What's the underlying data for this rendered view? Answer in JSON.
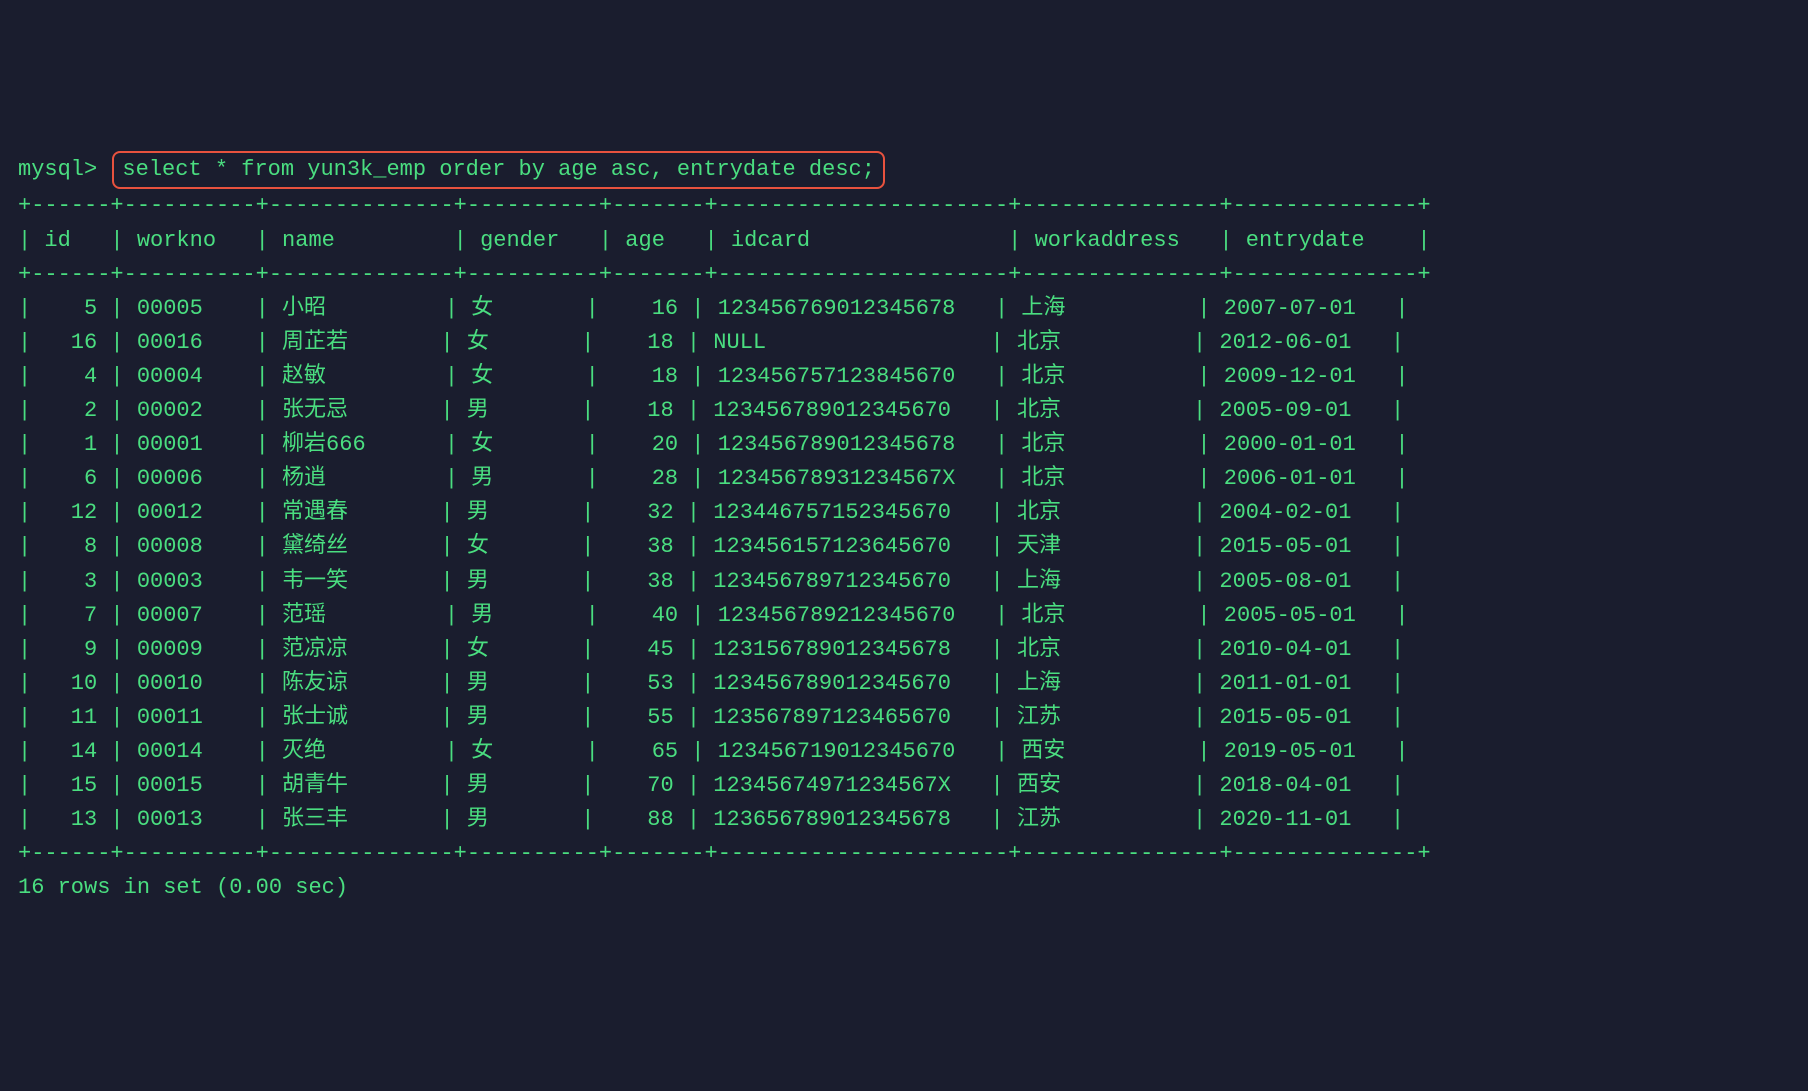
{
  "prompt": "mysql>",
  "query": "select * from yun3k_emp order by age asc, entrydate desc;",
  "columns": [
    "id",
    "workno",
    "name",
    "gender",
    "age",
    "idcard",
    "workaddress",
    "entrydate"
  ],
  "rows": [
    {
      "id": "5",
      "workno": "00005",
      "name": "小昭",
      "gender": "女",
      "age": "16",
      "idcard": "123456769012345678",
      "workaddress": "上海",
      "entrydate": "2007-07-01"
    },
    {
      "id": "16",
      "workno": "00016",
      "name": "周芷若",
      "gender": "女",
      "age": "18",
      "idcard": "NULL",
      "workaddress": "北京",
      "entrydate": "2012-06-01"
    },
    {
      "id": "4",
      "workno": "00004",
      "name": "赵敏",
      "gender": "女",
      "age": "18",
      "idcard": "123456757123845670",
      "workaddress": "北京",
      "entrydate": "2009-12-01"
    },
    {
      "id": "2",
      "workno": "00002",
      "name": "张无忌",
      "gender": "男",
      "age": "18",
      "idcard": "123456789012345670",
      "workaddress": "北京",
      "entrydate": "2005-09-01"
    },
    {
      "id": "1",
      "workno": "00001",
      "name": "柳岩666",
      "gender": "女",
      "age": "20",
      "idcard": "123456789012345678",
      "workaddress": "北京",
      "entrydate": "2000-01-01"
    },
    {
      "id": "6",
      "workno": "00006",
      "name": "杨逍",
      "gender": "男",
      "age": "28",
      "idcard": "12345678931234567X",
      "workaddress": "北京",
      "entrydate": "2006-01-01"
    },
    {
      "id": "12",
      "workno": "00012",
      "name": "常遇春",
      "gender": "男",
      "age": "32",
      "idcard": "123446757152345670",
      "workaddress": "北京",
      "entrydate": "2004-02-01"
    },
    {
      "id": "8",
      "workno": "00008",
      "name": "黛绮丝",
      "gender": "女",
      "age": "38",
      "idcard": "123456157123645670",
      "workaddress": "天津",
      "entrydate": "2015-05-01"
    },
    {
      "id": "3",
      "workno": "00003",
      "name": "韦一笑",
      "gender": "男",
      "age": "38",
      "idcard": "123456789712345670",
      "workaddress": "上海",
      "entrydate": "2005-08-01"
    },
    {
      "id": "7",
      "workno": "00007",
      "name": "范瑶",
      "gender": "男",
      "age": "40",
      "idcard": "123456789212345670",
      "workaddress": "北京",
      "entrydate": "2005-05-01"
    },
    {
      "id": "9",
      "workno": "00009",
      "name": "范凉凉",
      "gender": "女",
      "age": "45",
      "idcard": "123156789012345678",
      "workaddress": "北京",
      "entrydate": "2010-04-01"
    },
    {
      "id": "10",
      "workno": "00010",
      "name": "陈友谅",
      "gender": "男",
      "age": "53",
      "idcard": "123456789012345670",
      "workaddress": "上海",
      "entrydate": "2011-01-01"
    },
    {
      "id": "11",
      "workno": "00011",
      "name": "张士诚",
      "gender": "男",
      "age": "55",
      "idcard": "123567897123465670",
      "workaddress": "江苏",
      "entrydate": "2015-05-01"
    },
    {
      "id": "14",
      "workno": "00014",
      "name": "灭绝",
      "gender": "女",
      "age": "65",
      "idcard": "123456719012345670",
      "workaddress": "西安",
      "entrydate": "2019-05-01"
    },
    {
      "id": "15",
      "workno": "00015",
      "name": "胡青牛",
      "gender": "男",
      "age": "70",
      "idcard": "12345674971234567X",
      "workaddress": "西安",
      "entrydate": "2018-04-01"
    },
    {
      "id": "13",
      "workno": "00013",
      "name": "张三丰",
      "gender": "男",
      "age": "88",
      "idcard": "123656789012345678",
      "workaddress": "江苏",
      "entrydate": "2020-11-01"
    }
  ],
  "footer": "16 rows in set (0.00 sec)",
  "colWidths": {
    "id": 4,
    "workno": 8,
    "name": 12,
    "gender": 8,
    "age": 5,
    "idcard": 20,
    "workaddress": 13,
    "entrydate": 12
  }
}
